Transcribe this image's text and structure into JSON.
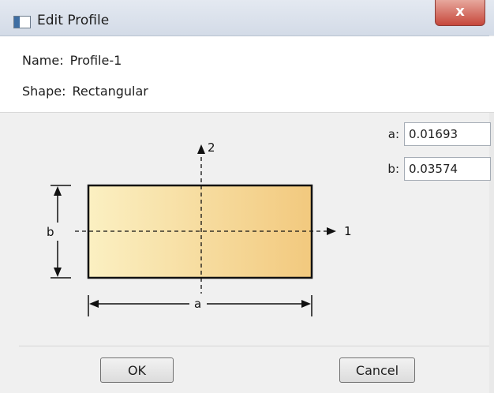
{
  "window": {
    "title": "Edit Profile",
    "close_glyph": "x"
  },
  "profile": {
    "name_label": "Name:",
    "name_value": "Profile-1",
    "shape_label": "Shape:",
    "shape_value": "Rectangular"
  },
  "parameters": [
    {
      "label": "a:",
      "value": "0.01693"
    },
    {
      "label": "b:",
      "value": "0.03574"
    }
  ],
  "diagram": {
    "axis_1_label": "1",
    "axis_2_label": "2",
    "dim_a_label": "a",
    "dim_b_label": "b",
    "fill_color_light": "#fbf0c2",
    "fill_color_dark": "#f2c97e"
  },
  "buttons": {
    "ok": "OK",
    "cancel": "Cancel"
  }
}
